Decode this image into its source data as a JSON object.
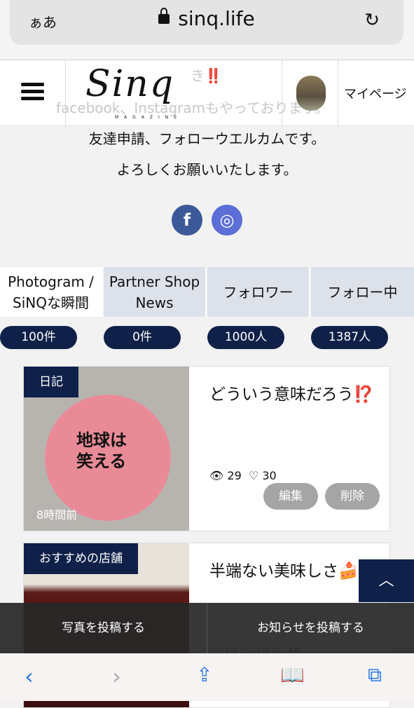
{
  "browser": {
    "aa": "ぁあ",
    "url": "sinq.life",
    "reload_icon": "reload-icon"
  },
  "header": {
    "logo": "Sinq",
    "logo_sub": "MAGAZINE",
    "mypage": "マイページ",
    "ghost_1": "き‼️",
    "ghost_2": "facebook、Instagramもやっております。"
  },
  "intro": {
    "line1": "友達申請、フォローウエルカムです。",
    "line2": "よろしくお願いいたします。",
    "facebook": "f",
    "instagram": "◎"
  },
  "tabs": [
    {
      "label": "Photogram / SiNQな瞬間",
      "count": "100件"
    },
    {
      "label": "Partner Shop News",
      "count": "0件"
    },
    {
      "label": "フォロワー",
      "count": "1000人"
    },
    {
      "label": "フォロー中",
      "count": "1387人"
    }
  ],
  "posts": [
    {
      "category": "日記",
      "title": "どういう意味だろう⁉️",
      "views": "29",
      "likes": "30",
      "edit": "編集",
      "delete": "削除",
      "ago": "8時間前",
      "image_text": "地球は笑える"
    },
    {
      "category": "おすすめの店舗",
      "title": "半端ない美味しさ🍰🍓",
      "comments": "17",
      "views": "79",
      "likes": "45"
    }
  ],
  "post_bar": {
    "photo": "写真を投稿する",
    "news": "お知らせを投稿する"
  },
  "colors": {
    "navy": "#0f2149",
    "tab_bg": "#dde1ea",
    "safari_blue": "#2f7ae5"
  }
}
